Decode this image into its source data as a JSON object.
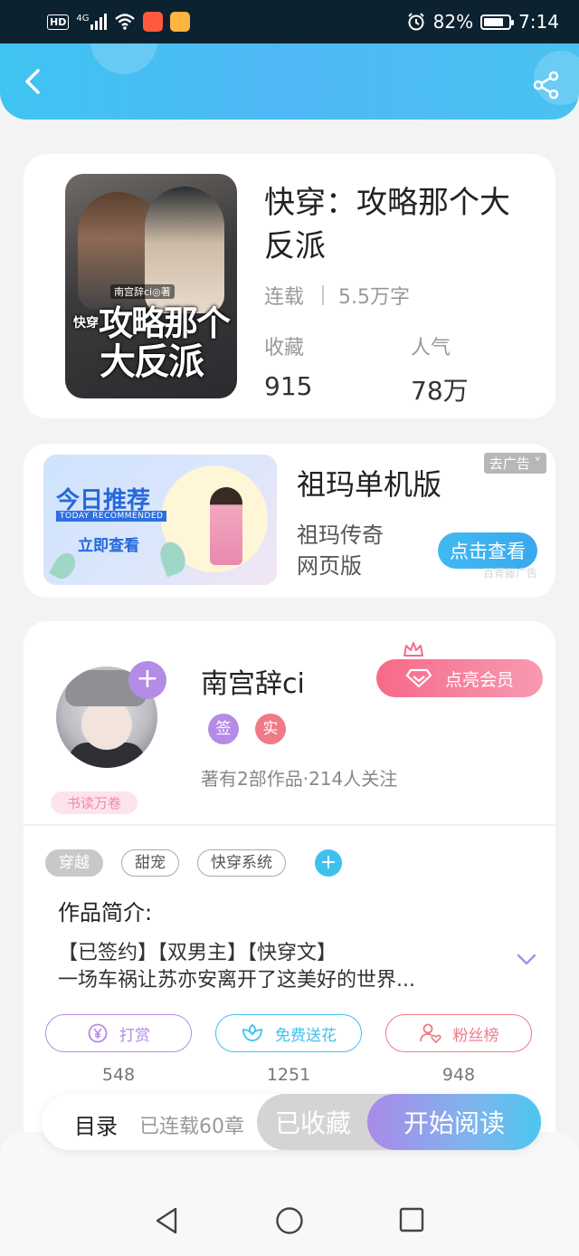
{
  "status_bar": {
    "network": "4G",
    "battery": "82%",
    "time": "7:14"
  },
  "header": {
    "back_icon": "chevron-left-icon",
    "share_icon": "share-icon"
  },
  "book": {
    "cover_author": "南宫辞ci◎著",
    "cover_line1": "攻略那个",
    "cover_line2": "大反派",
    "cover_tag": "快穿",
    "title": "快穿：攻略那个大反派",
    "status": "连载",
    "words": "5.5万字",
    "collect_label": "收藏",
    "collect_value": "915",
    "popularity_label": "人气",
    "popularity_value": "78万"
  },
  "ad": {
    "image_title": "今日推荐",
    "image_subtitle": "TODAY RECOMMENDED",
    "image_cta": "立即查看",
    "close_label": "去广告",
    "title": "祖玛单机版",
    "sub_line1": "祖玛传奇",
    "sub_line2": "网页版",
    "button": "点击查看",
    "source": "百青藤广告"
  },
  "author": {
    "name": "南宫辞ci",
    "badge": "书读万卷",
    "tag1": "签",
    "tag2": "实",
    "info": "著有2部作品·214人关注",
    "vip_button": "点亮会员"
  },
  "genres": [
    "穿越",
    "甜宠",
    "快穿系统"
  ],
  "intro": {
    "title": "作品简介:",
    "line1": "【已签约】【双男主】【快穿文】",
    "line2": "一场车祸让苏亦安离开了这美好的世界..."
  },
  "actions": [
    {
      "label": "打赏",
      "count": "548",
      "color": "#b48be6"
    },
    {
      "label": "免费送花",
      "count": "1251",
      "color": "#3fc1ef"
    },
    {
      "label": "粉丝榜",
      "count": "948",
      "color": "#f07a86"
    }
  ],
  "bottom_bar": {
    "toc": "目录",
    "chapters": "已连载60章",
    "collected": "已收藏",
    "read": "开始阅读"
  },
  "colors": {
    "header": "#4fb8f5",
    "accent_purple": "#b48be6",
    "accent_blue": "#3fc1ef",
    "accent_pink": "#f66a88"
  }
}
